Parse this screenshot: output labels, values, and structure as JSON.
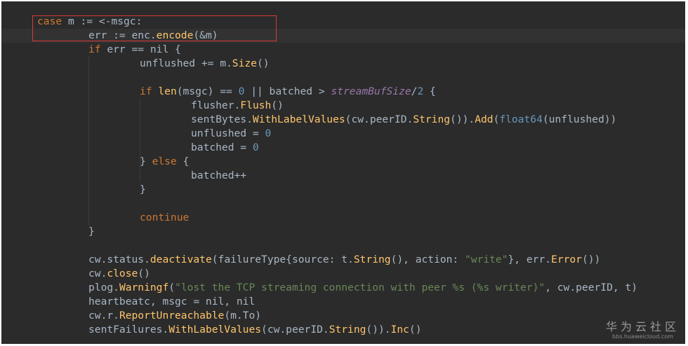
{
  "editor": {
    "colors": {
      "background": "#2b2b2b",
      "keyword": "#cc7832",
      "identifier": "#a9b7c6",
      "function": "#ffc66d",
      "number": "#6897bb",
      "string": "#6a8759",
      "constant": "#9876aa",
      "highlight_box": "#d83a3a"
    },
    "lines": [
      {
        "indent": 0,
        "tokens": [
          [
            "kw",
            "case"
          ],
          [
            "plain",
            " m := <-msgc:"
          ]
        ]
      },
      {
        "indent": 1,
        "tokens": [
          [
            "plain",
            "err := enc."
          ],
          [
            "fn",
            "encode"
          ],
          [
            "plain",
            "(&m)"
          ]
        ]
      },
      {
        "indent": 1,
        "tokens": [
          [
            "kw",
            "if"
          ],
          [
            "plain",
            " err == nil {"
          ]
        ]
      },
      {
        "indent": 2,
        "tokens": [
          [
            "plain",
            "unflushed += m."
          ],
          [
            "fn",
            "Size"
          ],
          [
            "plain",
            "()"
          ]
        ]
      },
      {
        "indent": 0,
        "tokens": []
      },
      {
        "indent": 2,
        "tokens": [
          [
            "kw",
            "if"
          ],
          [
            "plain",
            " "
          ],
          [
            "fn",
            "len"
          ],
          [
            "plain",
            "(msgc) == "
          ],
          [
            "num",
            "0"
          ],
          [
            "plain",
            " || batched > "
          ],
          [
            "const",
            "streamBufSize"
          ],
          [
            "plain",
            "/"
          ],
          [
            "num",
            "2"
          ],
          [
            "plain",
            " {"
          ]
        ]
      },
      {
        "indent": 3,
        "tokens": [
          [
            "plain",
            "flusher."
          ],
          [
            "fn",
            "Flush"
          ],
          [
            "plain",
            "()"
          ]
        ]
      },
      {
        "indent": 3,
        "tokens": [
          [
            "plain",
            "sentBytes."
          ],
          [
            "fn",
            "WithLabelValues"
          ],
          [
            "plain",
            "(cw.peerID."
          ],
          [
            "fn",
            "String"
          ],
          [
            "plain",
            "())."
          ],
          [
            "fn",
            "Add"
          ],
          [
            "plain",
            "("
          ],
          [
            "builtin",
            "float64"
          ],
          [
            "plain",
            "(unflushed))"
          ]
        ]
      },
      {
        "indent": 3,
        "tokens": [
          [
            "plain",
            "unflushed = "
          ],
          [
            "num",
            "0"
          ]
        ]
      },
      {
        "indent": 3,
        "tokens": [
          [
            "plain",
            "batched = "
          ],
          [
            "num",
            "0"
          ]
        ]
      },
      {
        "indent": 2,
        "tokens": [
          [
            "plain",
            "} "
          ],
          [
            "kw",
            "else"
          ],
          [
            "plain",
            " {"
          ]
        ]
      },
      {
        "indent": 3,
        "tokens": [
          [
            "plain",
            "batched++"
          ]
        ]
      },
      {
        "indent": 2,
        "tokens": [
          [
            "plain",
            "}"
          ]
        ]
      },
      {
        "indent": 0,
        "tokens": []
      },
      {
        "indent": 2,
        "tokens": [
          [
            "kw",
            "continue"
          ]
        ]
      },
      {
        "indent": 1,
        "tokens": [
          [
            "plain",
            "}"
          ]
        ]
      },
      {
        "indent": 0,
        "tokens": []
      },
      {
        "indent": 1,
        "tokens": [
          [
            "plain",
            "cw.status."
          ],
          [
            "fn",
            "deactivate"
          ],
          [
            "plain",
            "(failureType{source: t."
          ],
          [
            "fn",
            "String"
          ],
          [
            "plain",
            "(), action: "
          ],
          [
            "str",
            "\"write\""
          ],
          [
            "plain",
            "}, err."
          ],
          [
            "fn",
            "Error"
          ],
          [
            "plain",
            "())"
          ]
        ]
      },
      {
        "indent": 1,
        "tokens": [
          [
            "plain",
            "cw."
          ],
          [
            "fn",
            "close"
          ],
          [
            "plain",
            "()"
          ]
        ]
      },
      {
        "indent": 1,
        "tokens": [
          [
            "plain",
            "plog."
          ],
          [
            "fn",
            "Warningf"
          ],
          [
            "plain",
            "("
          ],
          [
            "str",
            "\"lost the TCP streaming connection with peer %s (%s writer)\""
          ],
          [
            "plain",
            ", cw.peerID, t)"
          ]
        ]
      },
      {
        "indent": 1,
        "tokens": [
          [
            "plain",
            "heartbeatc, msgc = nil, nil"
          ]
        ]
      },
      {
        "indent": 1,
        "tokens": [
          [
            "plain",
            "cw.r."
          ],
          [
            "fn",
            "ReportUnreachable"
          ],
          [
            "plain",
            "(m.To)"
          ]
        ]
      },
      {
        "indent": 1,
        "tokens": [
          [
            "plain",
            "sentFailures."
          ],
          [
            "fn",
            "WithLabelValues"
          ],
          [
            "plain",
            "(cw.peerID."
          ],
          [
            "fn",
            "String"
          ],
          [
            "plain",
            "())."
          ],
          [
            "fn",
            "Inc"
          ],
          [
            "plain",
            "()"
          ]
        ]
      }
    ]
  },
  "watermark": {
    "title": "华为云社区",
    "url": "bbs.huaweicloud.com"
  }
}
